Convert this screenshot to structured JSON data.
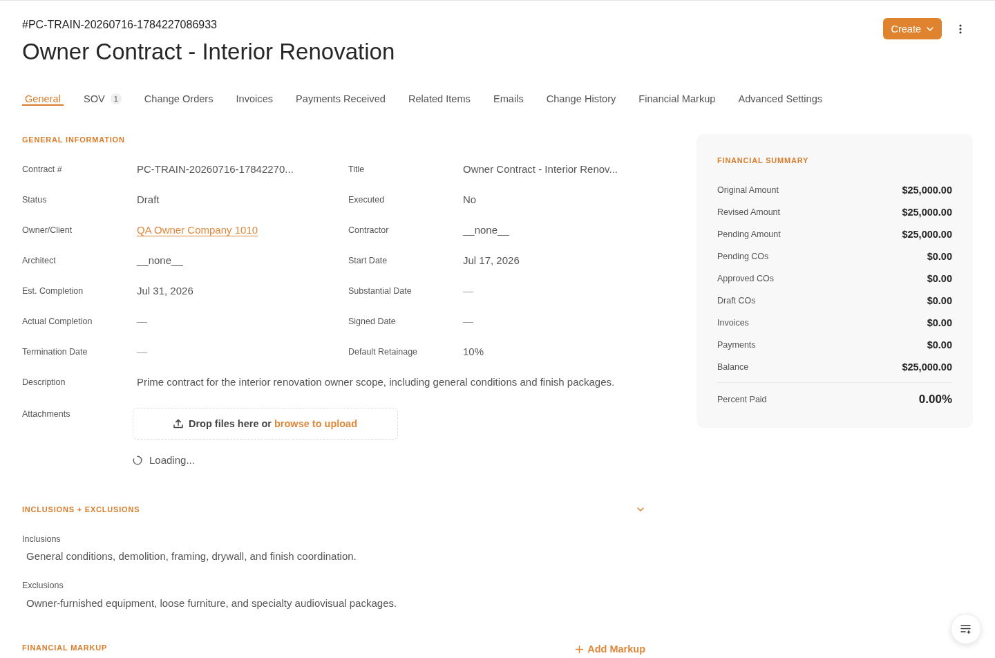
{
  "header": {
    "record_id": "#PC-TRAIN-20260716-1784227086933",
    "title": "Owner Contract - Interior Renovation",
    "create_button": "Create"
  },
  "tabs": [
    {
      "label": "General",
      "selected": true
    },
    {
      "label": "SOV",
      "badge": "1",
      "selected": false
    },
    {
      "label": "Change Orders",
      "selected": false
    },
    {
      "label": "Invoices",
      "selected": false
    },
    {
      "label": "Payments Received",
      "selected": false
    },
    {
      "label": "Related Items",
      "selected": false
    },
    {
      "label": "Emails",
      "selected": false
    },
    {
      "label": "Change History",
      "selected": false
    },
    {
      "label": "Financial Markup",
      "selected": false
    },
    {
      "label": "Advanced Settings",
      "selected": false
    }
  ],
  "general_information": {
    "heading": "GENERAL INFORMATION",
    "fields": [
      {
        "label": "Contract #",
        "value": "PC-TRAIN-20260716-17842270...",
        "kind": "text"
      },
      {
        "label": "Title",
        "value": "Owner Contract - Interior Renov...",
        "kind": "text"
      },
      {
        "label": "Status",
        "value": "Draft",
        "kind": "text"
      },
      {
        "label": "Executed",
        "value": "No",
        "kind": "text"
      },
      {
        "label": "Owner/Client",
        "value": "QA Owner Company 1010",
        "kind": "link"
      },
      {
        "label": "Contractor",
        "value": "__none__",
        "kind": "text"
      },
      {
        "label": "Architect",
        "value": "__none__",
        "kind": "text"
      },
      {
        "label": "Start Date",
        "value": "Jul 17, 2026",
        "kind": "text"
      },
      {
        "label": "Est. Completion",
        "value": "Jul 31, 2026",
        "kind": "text"
      },
      {
        "label": "Substantial Date",
        "value": "—",
        "kind": "dash"
      },
      {
        "label": "Actual Completion",
        "value": "—",
        "kind": "dash"
      },
      {
        "label": "Signed Date",
        "value": "—",
        "kind": "dash"
      },
      {
        "label": "Termination Date",
        "value": "—",
        "kind": "dash"
      },
      {
        "label": "Default Retainage",
        "value": "10%",
        "kind": "text"
      },
      {
        "label": "Description",
        "value": "Prime contract for the interior renovation owner scope, including general conditions and finish packages.",
        "kind": "paragraph"
      }
    ],
    "attachments": {
      "label": "Attachments",
      "dropzone_text": "Drop files here or",
      "browse_link": "browse to upload",
      "status": "Loading..."
    }
  },
  "inclusions_exclusions": {
    "heading": "INCLUSIONS + EXCLUSIONS",
    "expanded": true,
    "items": [
      {
        "label": "Inclusions",
        "text": "General conditions, demolition, framing, drywall, and finish coordination."
      },
      {
        "label": "Exclusions",
        "text": "Owner-furnished equipment, loose furniture, and specialty audiovisual packages."
      }
    ]
  },
  "financial_markup": {
    "heading": "FINANCIAL MARKUP",
    "add_button": "Add Markup"
  },
  "financial_summary": {
    "heading": "FINANCIAL SUMMARY",
    "rows": [
      {
        "label": "Original Amount",
        "value": "$25,000.00"
      },
      {
        "label": "Revised Amount",
        "value": "$25,000.00"
      },
      {
        "label": "Pending Amount",
        "value": "$25,000.00"
      },
      {
        "label": "Pending COs",
        "value": "$0.00"
      },
      {
        "label": "Approved COs",
        "value": "$0.00"
      },
      {
        "label": "Draft COs",
        "value": "$0.00"
      },
      {
        "label": "Invoices",
        "value": "$0.00"
      },
      {
        "label": "Payments",
        "value": "$0.00"
      },
      {
        "label": "Balance",
        "value": "$25,000.00"
      }
    ],
    "total": {
      "label": "Percent Paid",
      "value": "0.00%"
    }
  }
}
